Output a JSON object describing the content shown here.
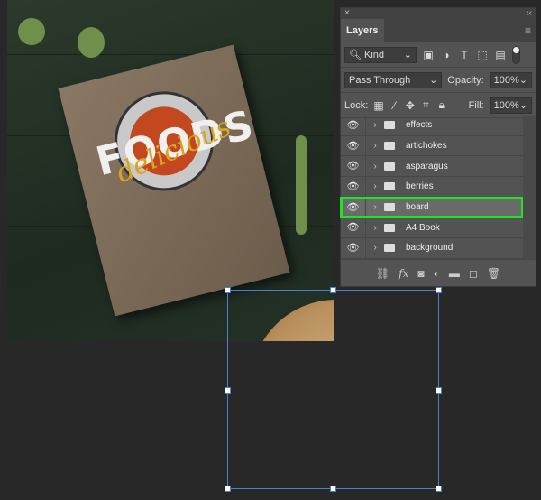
{
  "canvas": {
    "artwork_text": {
      "title": "FOODS",
      "script": "delicious"
    }
  },
  "panel": {
    "close_label": "×",
    "collapse_label": "‹‹",
    "tab": "Layers",
    "menu_icon": "hamburger-icon",
    "filter": {
      "value": "Kind",
      "icons": [
        "image-icon",
        "adjustment-icon",
        "type-icon",
        "shape-icon",
        "smart-object-icon"
      ]
    },
    "blend_mode": "Pass Through",
    "opacity_label": "Opacity:",
    "opacity": "100%",
    "lock_label": "Lock:",
    "fill_label": "Fill:",
    "fill": "100%",
    "layers": [
      {
        "name": "effects",
        "selected": false
      },
      {
        "name": "artichokes",
        "selected": false
      },
      {
        "name": "asparagus",
        "selected": false
      },
      {
        "name": "berries",
        "selected": false
      },
      {
        "name": "board",
        "selected": true
      },
      {
        "name": "A4 Book",
        "selected": false
      },
      {
        "name": "background",
        "selected": false
      }
    ],
    "highlight_color": "#1ee61e"
  }
}
